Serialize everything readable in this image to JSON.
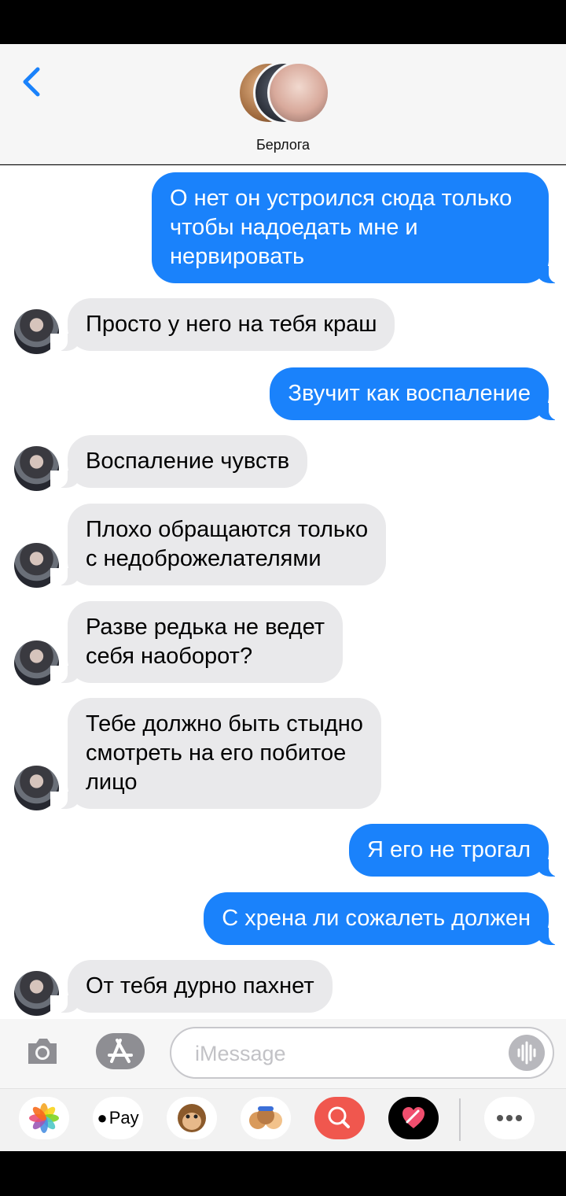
{
  "header": {
    "contact_name": "Берлога",
    "back_icon": "chevron-left-icon"
  },
  "messages": [
    {
      "direction": "outgoing",
      "text": "О нет он устроился сюда только\nчтобы надоедать мне и\nнервировать"
    },
    {
      "direction": "incoming",
      "text": "Просто у него на тебя краш"
    },
    {
      "direction": "outgoing",
      "text": "Звучит как воспаление"
    },
    {
      "direction": "incoming",
      "text": "Воспаление чувств"
    },
    {
      "direction": "incoming",
      "text": "Плохо обращаются только\nс недоброжелателями"
    },
    {
      "direction": "incoming",
      "text": "Разве редька не ведет\nсебя наоборот?"
    },
    {
      "direction": "incoming",
      "text": "Тебе должно быть стыдно\nсмотреть на его побитое\nлицо"
    },
    {
      "direction": "outgoing",
      "text": "Я его не трогал"
    },
    {
      "direction": "outgoing",
      "text": "С хрена ли сожалеть должен"
    },
    {
      "direction": "incoming",
      "text": "От тебя дурно пахнет"
    }
  ],
  "input": {
    "placeholder": "iMessage",
    "camera_icon": "camera-icon",
    "apps_icon": "app-store-icon",
    "audio_icon": "audio-waveform-icon"
  },
  "app_tray": {
    "apple_pay_label": "Pay",
    "items": [
      "photos-icon",
      "apple-pay-icon",
      "monkey-animoji-icon",
      "memoji-icon",
      "search-images-icon",
      "digital-touch-icon",
      "more-icon"
    ]
  },
  "colors": {
    "outgoing_bubble": "#1a82fb",
    "incoming_bubble": "#e9e9eb",
    "accent": "#1a82fb"
  }
}
